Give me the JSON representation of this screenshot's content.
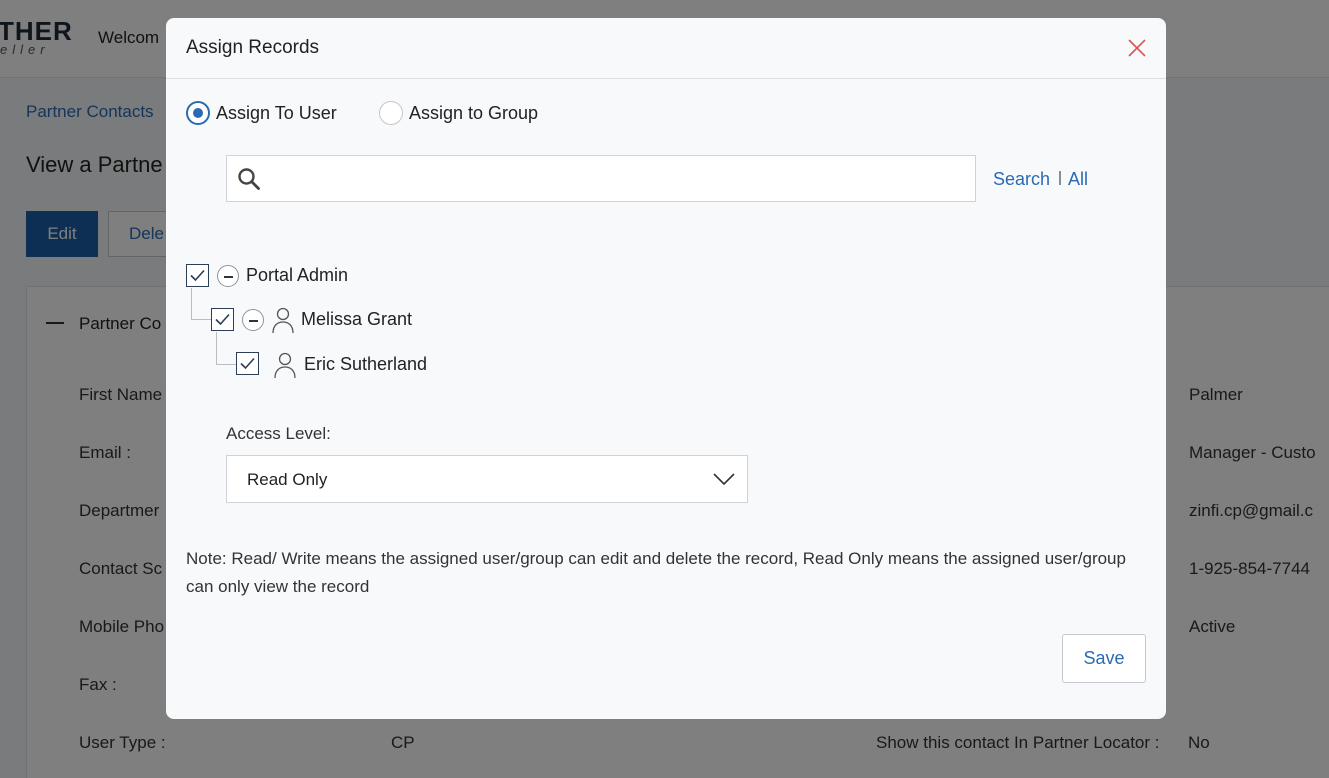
{
  "header": {
    "logo_text": "THER",
    "logo_sub": "eller",
    "welcome": "Welcom"
  },
  "breadcrumb": "Partner Contacts",
  "page_title": "View a Partne",
  "actions": {
    "edit_label": "Edit",
    "delete_label": "Dele"
  },
  "panel": {
    "title": "Partner Co",
    "left_labels": [
      "First Name",
      "Email :",
      "Departmer",
      "Contact Sc",
      "Mobile Pho",
      "Fax :",
      "User Type :"
    ],
    "right_values": [
      "Palmer",
      "Manager - Custo",
      "zinfi.cp@gmail.c",
      "1-925-854-7744",
      "Active"
    ],
    "user_type_value": "CP",
    "locator_label": "Show this contact In Partner Locator :",
    "locator_value": "No"
  },
  "modal": {
    "title": "Assign Records",
    "close_icon": "close-icon",
    "assign_options": [
      {
        "label": "Assign To User",
        "selected": true
      },
      {
        "label": "Assign to Group",
        "selected": false
      }
    ],
    "search": {
      "placeholder": "",
      "value": "",
      "search_label": "Search",
      "all_label": "All"
    },
    "tree": [
      {
        "label": "Portal Admin",
        "checked": true,
        "expanded": true,
        "icon": ""
      },
      {
        "label": "Melissa Grant",
        "checked": true,
        "expanded": true,
        "icon": "person-icon"
      },
      {
        "label": "Eric Sutherland",
        "checked": true,
        "icon": "person-icon"
      }
    ],
    "access_level": {
      "label": "Access Level:",
      "selected": "Read Only"
    },
    "note": "Note: Read/ Write means the assigned user/group can edit and delete the record, Read Only means the assigned user/group can only view the record",
    "save_label": "Save"
  },
  "colors": {
    "accent": "#2a6ab3",
    "primary_button": "#1d5ea8",
    "close": "#d9534f"
  }
}
